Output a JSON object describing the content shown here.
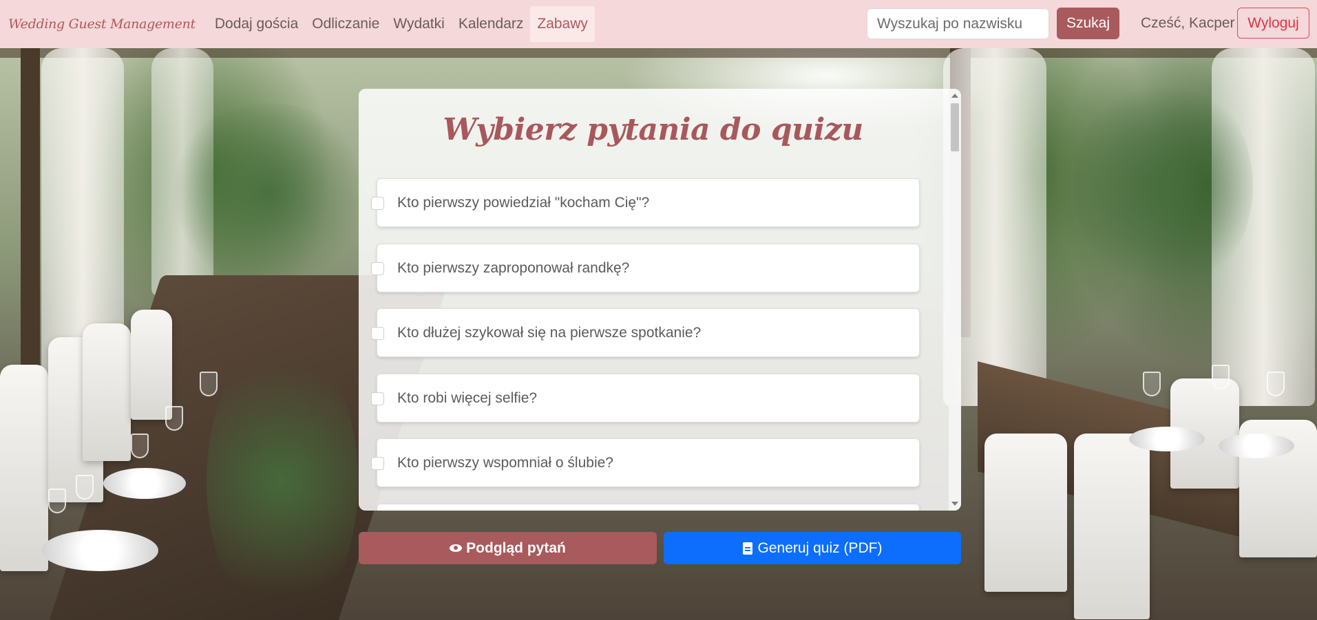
{
  "navbar": {
    "brand": "Wedding Guest Management",
    "links": [
      {
        "label": "Dodaj gościa"
      },
      {
        "label": "Odliczanie"
      },
      {
        "label": "Wydatki"
      },
      {
        "label": "Kalendarz"
      },
      {
        "label": "Zabawy",
        "active": true
      }
    ],
    "search": {
      "placeholder": "Wyszukaj po nazwisku",
      "button_label": "Szukaj"
    },
    "greeting": "Cześć, Kacper",
    "logout_label": "Wyloguj"
  },
  "quiz": {
    "title": "Wybierz pytania do quizu",
    "questions": [
      {
        "text": "Kto pierwszy powiedział \"kocham Cię\"?",
        "checked": false
      },
      {
        "text": "Kto pierwszy zaproponował randkę?",
        "checked": false
      },
      {
        "text": "Kto dłużej szykował się na pierwsze spotkanie?",
        "checked": false
      },
      {
        "text": "Kto robi więcej selfie?",
        "checked": false
      },
      {
        "text": "Kto pierwszy wspomniał o ślubie?",
        "checked": false
      }
    ]
  },
  "actions": {
    "preview_label": "Podgląd pytań",
    "generate_label": "Generuj quiz (PDF)"
  },
  "icons": {
    "preview": "eye-icon",
    "generate": "document-icon"
  },
  "colors": {
    "navbar_bg": "#f4d8da",
    "accent": "#a85a5c",
    "primary_blue": "#0d6efd",
    "logout_red": "#dc3545"
  }
}
